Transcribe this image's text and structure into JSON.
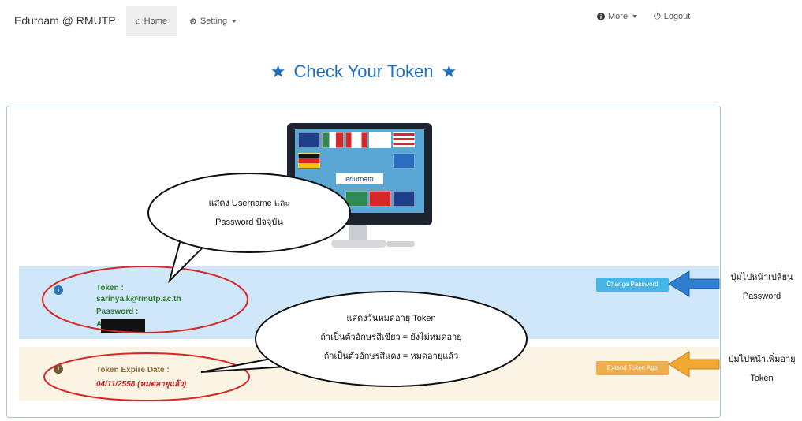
{
  "navbar": {
    "brand": "Eduroam @ RMUTP",
    "home": "Home",
    "setting": "Setting",
    "more": "More",
    "logout": "Logout"
  },
  "page": {
    "title": "Check Your Token",
    "star": "★"
  },
  "monitor": {
    "screen_label": "eduroam"
  },
  "token_info": {
    "icon": "i",
    "token_label": "Token :",
    "token_value": "sarinya.k@rmutp.ac.th",
    "password_label": "Password :",
    "password_value_prefix": "A",
    "change_password_button": "Change Password"
  },
  "token_expire": {
    "icon": "!",
    "label": "Token Expire Date :",
    "value": "04/11/2558 (หมดอายุแล้ว)",
    "extend_button": "Extend Token Age"
  },
  "annotations": {
    "bubble1_line1": "แสดง Username และ",
    "bubble1_line2": "Password ปัจจุบัน",
    "bubble2_line1": "แสดงวันหมดอายุ Token",
    "bubble2_line2": "ถ้าเป็นตัวอักษรสีเขียว = ยังไม่หมดอายุ",
    "bubble2_line3": "ถ้าเป็นตัวอักษรสีแดง = หมดอายุแล้ว",
    "side_blue_line1": "ปุ่มไปหน้าเปลี่ยน",
    "side_blue_line2": "Password",
    "side_orange_line1": "ปุ่มไปหน้าเพิ่มอายุ",
    "side_orange_line2": "Token"
  },
  "colors": {
    "accent_blue": "#1f6fc0",
    "info_bg": "#cfe7f8",
    "warning_bg": "#fbf3e3",
    "green_text": "#2e7d32",
    "red_text": "#cc1f1f",
    "ellipse_red": "#d62828",
    "arrow_blue": "#2f7fd1",
    "arrow_orange": "#f0a830"
  }
}
